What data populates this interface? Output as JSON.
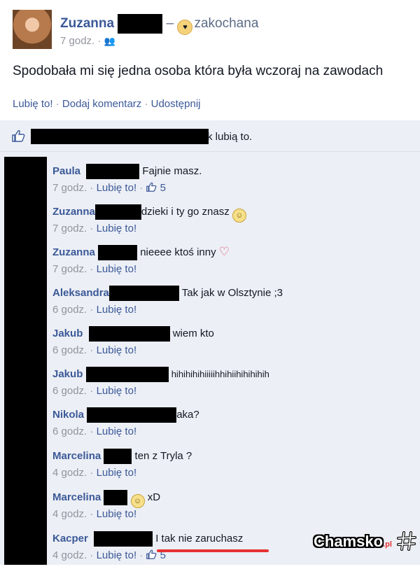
{
  "post": {
    "author": "Zuzanna",
    "separator": "–",
    "feeling": "zakochana",
    "time": "7 godz.",
    "dot": "·",
    "text": "Spodobała mi się jedna osoba która była wczoraj na zawodach",
    "actions": {
      "like": "Lubię to!",
      "comment": "Dodaj komentarz",
      "share": "Udostępnij",
      "sep": " · "
    }
  },
  "likes_bar": {
    "text": "k lubią to.",
    "icon": "thumbs-up-icon"
  },
  "comments": [
    {
      "author": "Paula",
      "text": "Fajnie masz.",
      "time": "7 godz.",
      "like": "Lubię to!",
      "likes": "5"
    },
    {
      "author": "Zuzanna",
      "text": "dzieki i ty go znasz",
      "time": "7 godz.",
      "like": "Lubię to!"
    },
    {
      "author": "Zuzanna",
      "text": "nieeee ktoś inny",
      "time": "7 godz.",
      "like": "Lubię to!"
    },
    {
      "author": "Aleksandra",
      "text": "Tak jak w Olsztynie ;3",
      "time": "6 godz.",
      "like": "Lubię to!"
    },
    {
      "author": "Jakub",
      "text": "wiem kto",
      "time": "6 godz.",
      "like": "Lubię to!"
    },
    {
      "author": "Jakub",
      "text": "hihihihihiiiiihhihiihihihihih",
      "time": "6 godz.",
      "like": "Lubię to!"
    },
    {
      "author": "Nikola",
      "text": "aka?",
      "time": "6 godz.",
      "like": "Lubię to!"
    },
    {
      "author": "Marcelina",
      "text": "ten z Tryla ?",
      "time": "4 godz.",
      "like": "Lubię to!"
    },
    {
      "author": "Marcelina",
      "text": "xD",
      "time": "4 godz.",
      "like": "Lubię to!"
    },
    {
      "author": "Kacper",
      "text": "I tak nie zaruchasz",
      "time": "4 godz.",
      "like": "Lubię to!",
      "likes": "5"
    }
  ],
  "watermark": {
    "brand": "Chamsko",
    "tld": ".pl"
  },
  "colors": {
    "link": "#3b5998",
    "meta": "#90949c",
    "comments_bg": "#eceff5",
    "highlight": "#e53131"
  }
}
